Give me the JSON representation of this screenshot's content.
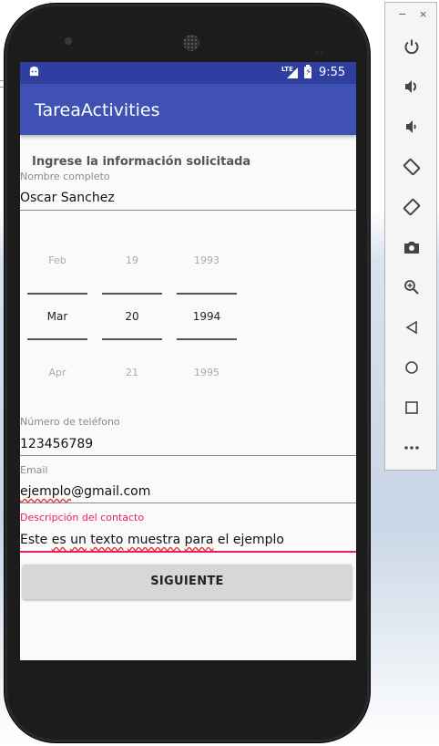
{
  "status_bar": {
    "network": "LTE",
    "time": "9:55"
  },
  "app": {
    "title": "TareaActivities"
  },
  "form": {
    "instruction": "Ingrese la información solicitada",
    "name": {
      "label": "Nombre completo",
      "value": "Oscar Sanchez"
    },
    "date_picker": {
      "month": {
        "prev": "Feb",
        "selected": "Mar",
        "next": "Apr"
      },
      "day": {
        "prev": "19",
        "selected": "20",
        "next": "21"
      },
      "year": {
        "prev": "1993",
        "selected": "1994",
        "next": "1995"
      }
    },
    "phone": {
      "label": "Número de teléfono",
      "value": "123456789"
    },
    "email": {
      "label": "Email",
      "value_misspelled": "ejemplo",
      "value_rest": "@gmail.com"
    },
    "description": {
      "label": "Descripción del contacto",
      "words": [
        "Este",
        "es",
        "un",
        "texto",
        "muestra",
        "para",
        "el",
        "ejemplo"
      ]
    },
    "next_button": "SIGUIENTE"
  },
  "emulator_panel": {
    "minimize": "−",
    "close": "×",
    "tools": [
      "power-icon",
      "volume-up-icon",
      "volume-down-icon",
      "rotate-left-icon",
      "rotate-right-icon",
      "camera-icon",
      "zoom-icon",
      "back-icon",
      "home-icon",
      "overview-icon",
      "more-icon"
    ]
  },
  "colors": {
    "primary": "#3f51b5",
    "primary_dark": "#303f9f",
    "accent": "#e91e63"
  }
}
